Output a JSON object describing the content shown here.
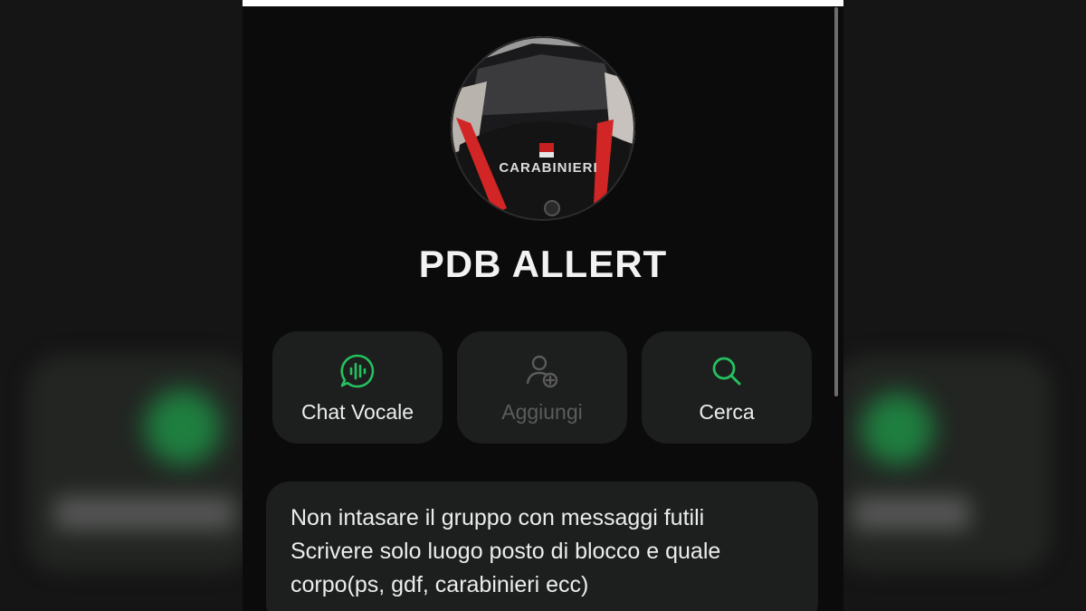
{
  "group": {
    "name": "PDB ALLERT",
    "avatar_text": "CARABINIERI"
  },
  "actions": [
    {
      "label": "Chat Vocale",
      "icon": "voice-chat-icon",
      "enabled": true
    },
    {
      "label": "Aggiungi",
      "icon": "add-user-icon",
      "enabled": false
    },
    {
      "label": "Cerca",
      "icon": "search-icon",
      "enabled": true
    }
  ],
  "description": {
    "lines": [
      "Non intasare il gruppo con messaggi futili",
      "Scrivere solo luogo posto di blocco e quale",
      "corpo(ps, gdf, carabinieri ecc)"
    ]
  },
  "colors": {
    "accent": "#25c15f",
    "background": "#0b0b0b",
    "card": "#1d1f1e",
    "disabled_text": "#5b5b5b"
  }
}
